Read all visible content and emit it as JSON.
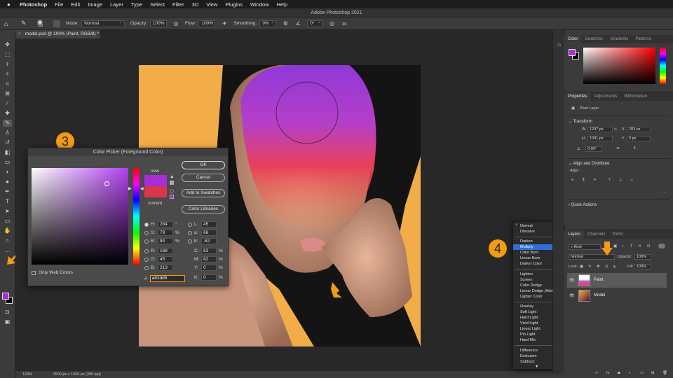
{
  "menubar": {
    "app": "Photoshop",
    "items": [
      "File",
      "Edit",
      "Image",
      "Layer",
      "Type",
      "Select",
      "Filter",
      "3D",
      "View",
      "Plugins",
      "Window",
      "Help"
    ]
  },
  "window_title": "Adobe Photoshop 2021",
  "options_bar": {
    "brush_size": "700",
    "mode_label": "Mode:",
    "mode_value": "Normal",
    "opacity_label": "Opacity:",
    "opacity_value": "100%",
    "flow_label": "Flow:",
    "flow_value": "100%",
    "smoothing_label": "Smoothing:",
    "smoothing_value": "0%",
    "angle_value": "0°"
  },
  "document_tab": {
    "title": "model.psd @ 100% (Paint, RGB/8) *",
    "close": "×"
  },
  "statusbar": {
    "zoom": "100%",
    "info": "1500 px x 1500 px (300 ppi)"
  },
  "color_picker": {
    "title": "Color Picker (Foreground Color)",
    "new_label": "new",
    "current_label": "current",
    "buttons": {
      "ok": "OK",
      "cancel": "Cancel",
      "add_swatches": "Add to Swatches",
      "libraries": "Color Libraries"
    },
    "fields": {
      "H": "284",
      "H_unit": "°",
      "S": "79",
      "S_unit": "%",
      "B": "84",
      "B_unit": "%",
      "R": "168",
      "G": "45",
      "Bl": "213",
      "L": "45",
      "a": "66",
      "b": "-62",
      "C": "63",
      "M": "82",
      "Y": "0",
      "K": "0",
      "pct": "%"
    },
    "hex_hash": "#",
    "hex": "a82dd5",
    "web_colors_label": "Only Web Colors",
    "new_color": "#a82dd5",
    "current_color": "#d9354d"
  },
  "callouts": {
    "left": "3",
    "right": "4"
  },
  "blend_menu": {
    "groups": [
      [
        "Normal",
        "Dissolve"
      ],
      [
        "Darken",
        "Multiply",
        "Color Burn",
        "Linear Burn",
        "Darker Color"
      ],
      [
        "Lighten",
        "Screen",
        "Color Dodge",
        "Linear Dodge (Add)",
        "Lighter Color"
      ],
      [
        "Overlay",
        "Soft Light",
        "Hard Light",
        "Vivid Light",
        "Linear Light",
        "Pin Light",
        "Hard Mix"
      ],
      [
        "Difference",
        "Exclusion",
        "Subtract"
      ]
    ],
    "selected": "Multiply",
    "checked": "Normal"
  },
  "color_panel": {
    "tabs": [
      "Color",
      "Swatches",
      "Gradients",
      "Patterns"
    ]
  },
  "properties_panel": {
    "tabs": [
      "Properties",
      "Adjustments",
      "Bibliotheken"
    ],
    "kind": "Pixel Layer",
    "transform_label": "Transform",
    "W_label": "W",
    "W": "1297 px",
    "X_label": "X",
    "X": "203 px",
    "H_label": "H",
    "H": "1001 px",
    "Y_label": "Y",
    "Y": "0 px",
    "angle": "0,00°",
    "align_label": "Align and Distribute",
    "align_sub": "Align:",
    "quick_actions": "Quick Actions"
  },
  "layers_panel": {
    "tabs": [
      "Layers",
      "Channels",
      "Paths"
    ],
    "filter": "Kind",
    "blend": "Normal",
    "opacity_label": "Opacity:",
    "opacity": "100%",
    "lock_label": "Lock:",
    "fill_label": "Fill:",
    "fill": "100%",
    "layers": [
      {
        "name": "Paint",
        "selected": true
      },
      {
        "name": "Model",
        "selected": false
      }
    ]
  },
  "colors": {
    "accent": "#f39c12",
    "foreground": "#a82dd5",
    "selection": "#2e6fd6"
  }
}
